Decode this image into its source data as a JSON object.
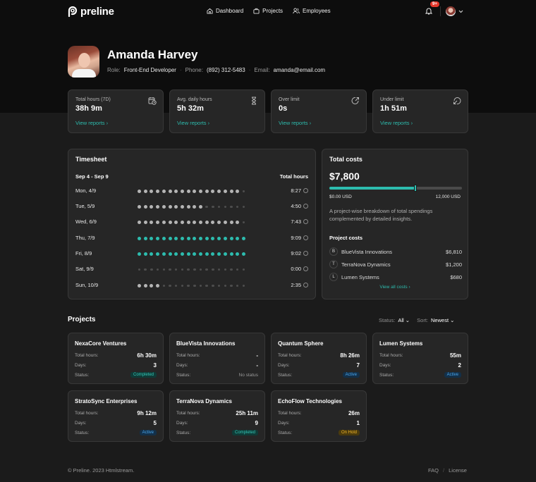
{
  "app": {
    "logo_text": "preline"
  },
  "nav": {
    "items": [
      {
        "label": "Dashboard",
        "icon": "home-icon"
      },
      {
        "label": "Projects",
        "icon": "briefcase-icon"
      },
      {
        "label": "Employees",
        "icon": "users-icon"
      }
    ]
  },
  "notifications": {
    "count": "9+"
  },
  "profile": {
    "name": "Amanda Harvey",
    "role_label": "Role:",
    "role": "Front-End Developer",
    "phone_label": "Phone:",
    "phone": "(892) 312-5483",
    "email_label": "Email:",
    "email": "amanda@email.com"
  },
  "stats": [
    {
      "label": "Total hours (7D)",
      "value": "38h 9m",
      "link": "View reports",
      "icon": "calendar-clock-icon"
    },
    {
      "label": "Avg. daily hours",
      "value": "5h 32m",
      "link": "View reports",
      "icon": "hourglass-icon"
    },
    {
      "label": "Over limit",
      "value": "0s",
      "link": "View reports",
      "icon": "arrow-up-right-circle-icon"
    },
    {
      "label": "Under limit",
      "value": "1h 51m",
      "link": "View reports",
      "icon": "arrow-down-left-circle-icon"
    }
  ],
  "timesheet": {
    "title": "Timesheet",
    "range": "Sep 4 - Sep 9",
    "total_label": "Total hours",
    "rows": [
      {
        "day": "Mon, 4/9",
        "filled": 17,
        "style": "gray",
        "time": "8:27"
      },
      {
        "day": "Tue, 5/9",
        "filled": 11,
        "style": "gray",
        "time": "4:50"
      },
      {
        "day": "Wed, 6/9",
        "filled": 17,
        "style": "gray",
        "time": "7:43"
      },
      {
        "day": "Thu, 7/9",
        "filled": 18,
        "style": "teal",
        "time": "9:09"
      },
      {
        "day": "Fri, 8/9",
        "filled": 18,
        "style": "teal",
        "time": "9:02"
      },
      {
        "day": "Sat, 9/9",
        "filled": 0,
        "style": "gray",
        "time": "0:00"
      },
      {
        "day": "Sun, 10/9",
        "filled": 4,
        "style": "gray",
        "time": "2:35"
      }
    ]
  },
  "costs": {
    "title": "Total costs",
    "total": "$7,800",
    "progress": 0.65,
    "min_label": "$0.00 USD",
    "max_label": "12,000 USD",
    "description": "A project-wise breakdown of total spendings complemented by detailed insights.",
    "projects_title": "Project costs",
    "items": [
      {
        "letter": "B",
        "name": "BlueVista Innovations",
        "amount": "$6,810"
      },
      {
        "letter": "T",
        "name": "TerraNova Dynamics",
        "amount": "$1,200"
      },
      {
        "letter": "L",
        "name": "Lumen Systems",
        "amount": "$680"
      }
    ],
    "view_all": "View all costs"
  },
  "projects": {
    "title": "Projects",
    "status_label": "Status:",
    "status_value": "All",
    "sort_label": "Sort:",
    "sort_value": "Newest",
    "hours_label": "Total hours:",
    "days_label": "Days:",
    "status_row_label": "Status:",
    "items": [
      {
        "name": "NexaCore Ventures",
        "hours": "6h 30m",
        "days": "3",
        "status": "Completed",
        "kind": "completed"
      },
      {
        "name": "BlueVista Innovations",
        "hours": "-",
        "days": "-",
        "status": "No status",
        "kind": "none"
      },
      {
        "name": "Quantum Sphere",
        "hours": "8h 26m",
        "days": "7",
        "status": "Active",
        "kind": "active"
      },
      {
        "name": "Lumen Systems",
        "hours": "55m",
        "days": "2",
        "status": "Active",
        "kind": "active"
      },
      {
        "name": "StratoSync Enterprises",
        "hours": "9h 12m",
        "days": "5",
        "status": "Active",
        "kind": "active"
      },
      {
        "name": "TerraNova Dynamics",
        "hours": "25h 11m",
        "days": "9",
        "status": "Completed",
        "kind": "completed"
      },
      {
        "name": "EchoFlow Technologies",
        "hours": "26m",
        "days": "1",
        "status": "On Hold",
        "kind": "onhold"
      }
    ]
  },
  "footer": {
    "copyright": "© Preline. 2023 Htmlstream.",
    "faq": "FAQ",
    "separator": "/",
    "license": "License"
  },
  "colors": {
    "accent": "#2dbcae",
    "bg": "#1b1b1b",
    "hero": "#0d0d0d",
    "card": "#262626"
  }
}
